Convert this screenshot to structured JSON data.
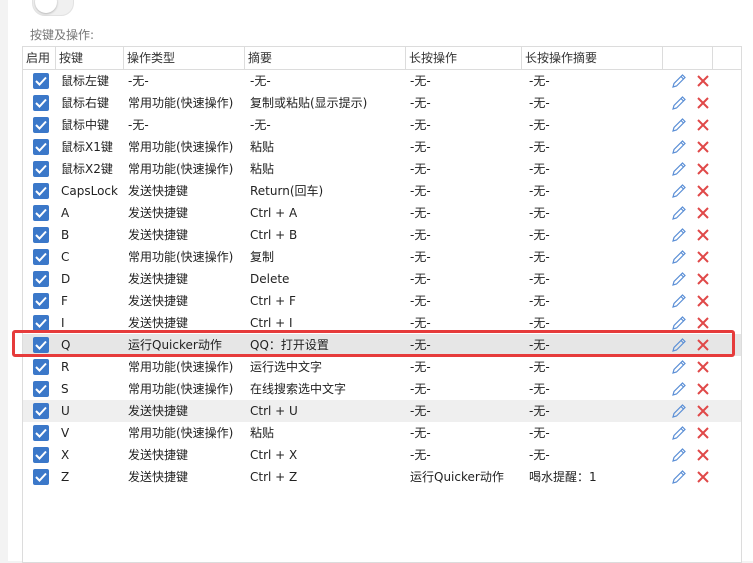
{
  "section_label": "按键及操作:",
  "columns": [
    "启用",
    "按键",
    "操作类型",
    "摘要",
    "长按操作",
    "长按操作摘要"
  ],
  "rows": [
    {
      "key": "鼠标左键",
      "type": "-无-",
      "summary": "-无-",
      "long": "-无-",
      "long_summary": "-无-"
    },
    {
      "key": "鼠标右键",
      "type": "常用功能(快速操作)",
      "summary": "复制或粘贴(显示提示)",
      "long": "-无-",
      "long_summary": "-无-"
    },
    {
      "key": "鼠标中键",
      "type": "-无-",
      "summary": "-无-",
      "long": "-无-",
      "long_summary": "-无-"
    },
    {
      "key": "鼠标X1键",
      "type": "常用功能(快速操作)",
      "summary": "粘贴",
      "long": "-无-",
      "long_summary": "-无-"
    },
    {
      "key": "鼠标X2键",
      "type": "常用功能(快速操作)",
      "summary": "粘贴",
      "long": "-无-",
      "long_summary": "-无-"
    },
    {
      "key": "CapsLock",
      "type": "发送快捷键",
      "summary": "Return(回车)",
      "long": "-无-",
      "long_summary": "-无-"
    },
    {
      "key": "A",
      "type": "发送快捷键",
      "summary": "Ctrl + A",
      "long": "-无-",
      "long_summary": "-无-"
    },
    {
      "key": "B",
      "type": "发送快捷键",
      "summary": "Ctrl + B",
      "long": "-无-",
      "long_summary": "-无-"
    },
    {
      "key": "C",
      "type": "常用功能(快速操作)",
      "summary": "复制",
      "long": "-无-",
      "long_summary": "-无-"
    },
    {
      "key": "D",
      "type": "发送快捷键",
      "summary": "Delete",
      "long": "-无-",
      "long_summary": "-无-"
    },
    {
      "key": "F",
      "type": "发送快捷键",
      "summary": "Ctrl + F",
      "long": "-无-",
      "long_summary": "-无-"
    },
    {
      "key": "I",
      "type": "发送快捷键",
      "summary": "Ctrl + I",
      "long": "-无-",
      "long_summary": "-无-"
    },
    {
      "key": "Q",
      "type": "运行Quicker动作",
      "summary": "QQ：打开设置",
      "long": "-无-",
      "long_summary": "-无-"
    },
    {
      "key": "R",
      "type": "常用功能(快速操作)",
      "summary": "运行选中文字",
      "long": "-无-",
      "long_summary": "-无-"
    },
    {
      "key": "S",
      "type": "常用功能(快速操作)",
      "summary": "在线搜索选中文字",
      "long": "-无-",
      "long_summary": "-无-"
    },
    {
      "key": "U",
      "type": "发送快捷键",
      "summary": "Ctrl + U",
      "long": "-无-",
      "long_summary": "-无-"
    },
    {
      "key": "V",
      "type": "常用功能(快速操作)",
      "summary": "粘贴",
      "long": "-无-",
      "long_summary": "-无-"
    },
    {
      "key": "X",
      "type": "发送快捷键",
      "summary": "Ctrl + X",
      "long": "-无-",
      "long_summary": "-无-"
    },
    {
      "key": "Z",
      "type": "发送快捷键",
      "summary": "Ctrl + Z",
      "long": "运行Quicker动作",
      "long_summary": "喝水提醒：1"
    }
  ],
  "selected_row": 12,
  "alt_row": 15,
  "colors": {
    "checkbox": "#3b78c9",
    "edit": "#5b8fd6",
    "delete": "#e04848",
    "highlight": "#e63b3b"
  },
  "icons": {
    "enabled": "checkbox-checked-icon",
    "edit": "pencil-icon",
    "delete": "close-x-icon"
  }
}
